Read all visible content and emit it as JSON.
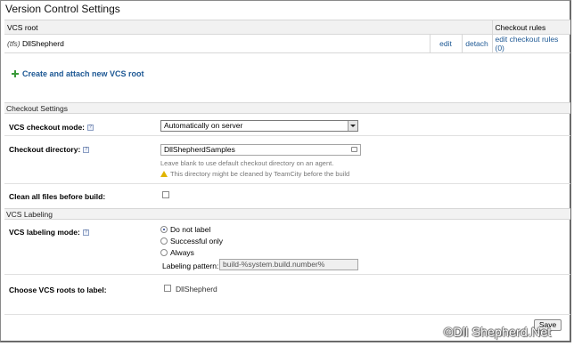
{
  "page": {
    "title": "Version Control Settings"
  },
  "vcs_table": {
    "headers": {
      "root": "VCS root",
      "rules": "Checkout rules"
    },
    "row": {
      "type": "(tfs)",
      "name": "DllShepherd",
      "edit": "edit",
      "detach": "detach",
      "rules_link": "edit checkout rules (0)"
    }
  },
  "create_link": "Create and attach new VCS root",
  "checkout": {
    "section": "Checkout Settings",
    "mode_label": "VCS checkout mode:",
    "mode_value": "Automatically on server",
    "dir_label": "Checkout directory:",
    "dir_value": "DllShepherdSamples",
    "dir_note": "Leave blank to use default checkout directory on an agent.",
    "dir_warning": "This directory might be cleaned by TeamCity before the build",
    "clean_label": "Clean all files before build:",
    "clean_checked": false
  },
  "labeling": {
    "section": "VCS Labeling",
    "mode_label": "VCS labeling mode:",
    "options": [
      "Do not label",
      "Successful only",
      "Always"
    ],
    "selected": 0,
    "pattern_label": "Labeling pattern:",
    "pattern_value": "build-%system.build.number%",
    "roots_label": "Choose VCS roots to label:",
    "root_option": "DllShepherd"
  },
  "save_label": "Save",
  "watermark": "©Dll Shepherd.Net",
  "colors": {
    "link": "#1d5894",
    "section_bg": "#f2f2f2",
    "warn": "#e0b400"
  }
}
